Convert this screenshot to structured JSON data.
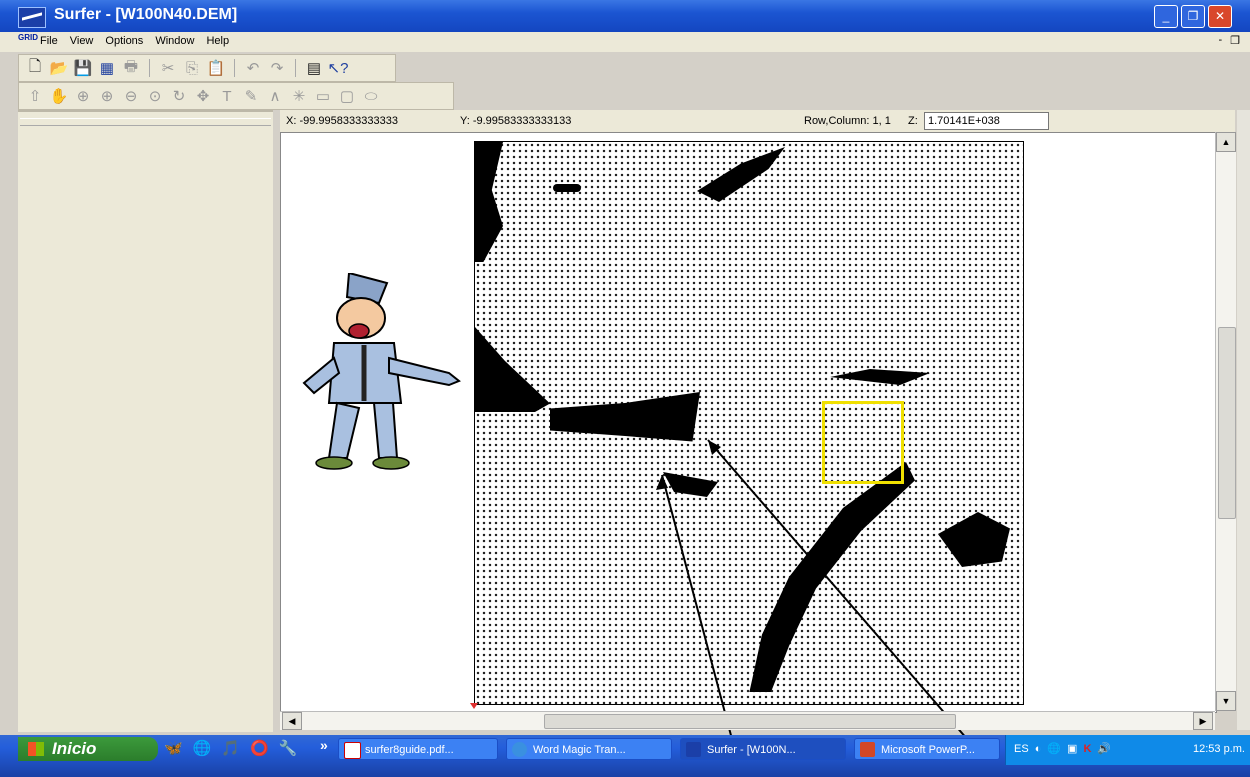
{
  "window": {
    "title": "Surfer - [W100N40.DEM]",
    "min": "_",
    "max": "❐",
    "close": "✕"
  },
  "menubar": {
    "grid_icon_label": "GRID",
    "items": [
      "File",
      "View",
      "Options",
      "Window",
      "Help"
    ],
    "mdi_min": "-",
    "mdi_restore": "❐"
  },
  "toolbar1": [
    "new-doc",
    "open-folder",
    "save",
    "grid",
    "print",
    "cut",
    "copy",
    "paste",
    "undo",
    "redo",
    "object-manager",
    "context-help"
  ],
  "toolbar2": [
    "select-arrow",
    "pan-hand",
    "zoom-rect",
    "zoom-in",
    "zoom-out",
    "zoom-fit",
    "rotate",
    "move",
    "text",
    "draw",
    "polyline",
    "symbol",
    "rectangle",
    "rounded-rect",
    "ellipse"
  ],
  "status": {
    "x_label": "X: -99.9958333333333",
    "y_label": "Y: -9.99583333333133",
    "z_prefix": "Z:",
    "z_value": "1.70141E+038",
    "rowcol": "Row,Column:  1, 1"
  },
  "taskbar": {
    "start_label": "Inicio",
    "tasks": [
      "surfer8guide.pdf...",
      "Word Magic Tran...",
      "Surfer - [W100N...",
      "Microsoft PowerP..."
    ],
    "tray_lang": "ES",
    "clock": "12:53 p.m."
  },
  "colors": {
    "title_blue": "#1b55d2",
    "highlight_yellow": "#f0e000",
    "taskbar_blue": "#245edb",
    "start_green": "#2b7d2b"
  }
}
